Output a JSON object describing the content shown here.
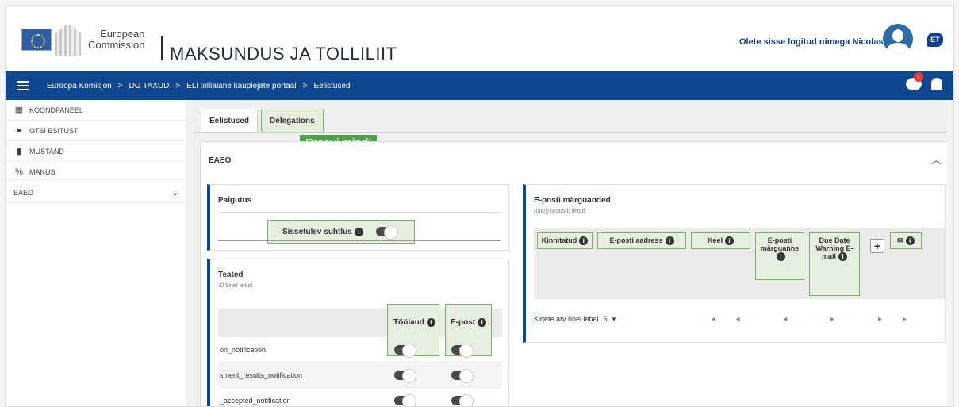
{
  "header": {
    "ec_line1": "European",
    "ec_line2": "Commission",
    "app_title": "MAKSUNDUS JA TOLLILIIT",
    "user_text": "Olete sisse logitud nimega Nicolas",
    "lang": "ET"
  },
  "nav": {
    "crumbs": [
      "Euroopa Komisjon",
      "DG TAXUD",
      "ELi tollialane kauplejate portaal",
      "Eelistused"
    ],
    "sep": ">",
    "notif_count": "1"
  },
  "sidebar": {
    "items": [
      {
        "icon": "dashboard-icon",
        "label": "KOONDPANEEL"
      },
      {
        "icon": "send-icon",
        "label": "OTSI ESITUST"
      },
      {
        "icon": "document-icon",
        "label": "MUSTAND"
      },
      {
        "icon": "attachment-icon",
        "label": "MANUS"
      },
      {
        "icon": "",
        "label": "EAEO"
      }
    ]
  },
  "tabs": [
    "Eelistused",
    "Delegations"
  ],
  "tooltip": "Proovi mind!",
  "section_title": "EAEO",
  "placement": {
    "title": "Paigutus",
    "incoming_label": "Sissetulev suhtlus"
  },
  "notices": {
    "title": "Teated",
    "count": "32 kirjet leitud",
    "col_desktop": "Töölaud",
    "col_email": "E-post",
    "rows": [
      "on_notification",
      "sment_results_notification",
      "_accepted_notification"
    ]
  },
  "email": {
    "title": "E-posti märguanded",
    "found": "{{arv}} üksus(t) leitud",
    "col1": "Kinnitatud",
    "col2": "E-posti aadress",
    "col3": "Keel",
    "col4": "E-posti märguanne",
    "col5": "Due Date Warning E-mail",
    "per_page": "Kirjete arv ühel lehel",
    "per_page_val": "5",
    "pager": "◂◂ ◂ ▸ ▸▸"
  },
  "colors": {
    "nav": "#0e4690",
    "highlight": "#e6efdf",
    "highlight_border": "#7fb069",
    "tooltip": "#50a14f"
  }
}
